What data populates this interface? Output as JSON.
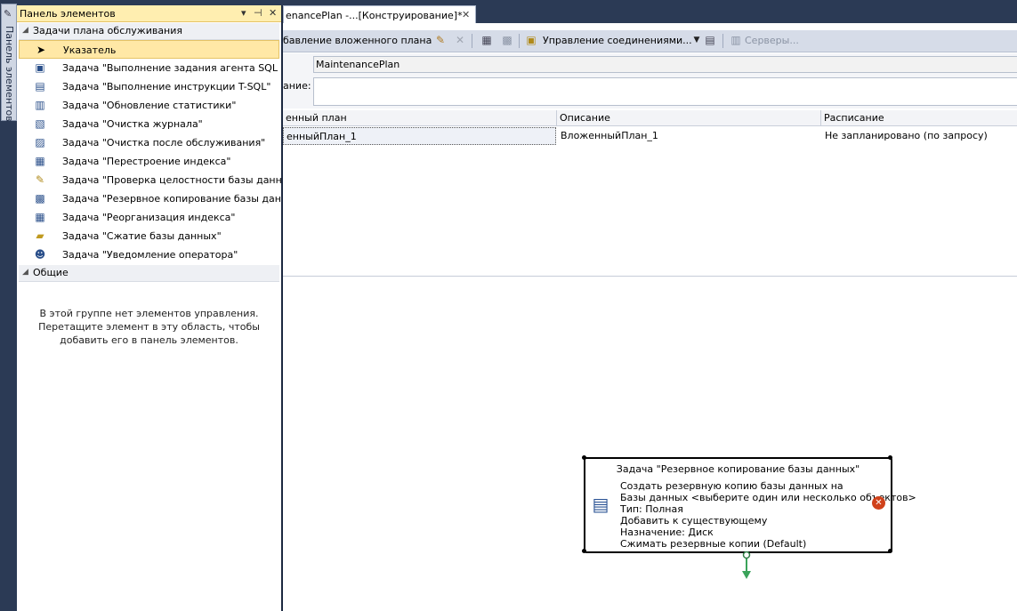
{
  "side_tab": {
    "label": "Панель элементов"
  },
  "toolbox": {
    "title": "Панель элементов",
    "groups": [
      {
        "label": "Задачи плана обслуживания",
        "items": [
          {
            "label": "Указатель",
            "icon": "pointer-icon"
          },
          {
            "label": "Задача \"Выполнение задания агента SQL Server\"",
            "icon": "agent-job-icon"
          },
          {
            "label": "Задача \"Выполнение инструкции T-SQL\"",
            "icon": "tsql-icon"
          },
          {
            "label": "Задача \"Обновление статистики\"",
            "icon": "statistics-icon"
          },
          {
            "label": "Задача \"Очистка журнала\"",
            "icon": "history-cleanup-icon"
          },
          {
            "label": "Задача \"Очистка после обслуживания\"",
            "icon": "maintenance-cleanup-icon"
          },
          {
            "label": "Задача \"Перестроение индекса\"",
            "icon": "rebuild-index-icon"
          },
          {
            "label": "Задача \"Проверка целостности базы данных\"",
            "icon": "integrity-check-icon"
          },
          {
            "label": "Задача \"Резервное копирование базы данных\"",
            "icon": "backup-icon"
          },
          {
            "label": "Задача \"Реорганизация индекса\"",
            "icon": "reorganize-index-icon"
          },
          {
            "label": "Задача \"Сжатие базы данных\"",
            "icon": "shrink-icon"
          },
          {
            "label": "Задача \"Уведомление оператора\"",
            "icon": "notify-operator-icon"
          }
        ]
      },
      {
        "label": "Общие",
        "empty_message": "В этой группе нет элементов управления. Перетащите элемент в эту область, чтобы добавить его в панель элементов."
      }
    ]
  },
  "document_tab": {
    "title": "enancePlan -...[Конструирование]*"
  },
  "toolbar": {
    "add_subplan_label": "бавление вложенного плана",
    "manage_connections_label": "Управление соединениями...",
    "servers_label": "Серверы..."
  },
  "properties": {
    "name_value": "MaintenancePlan",
    "description_label": "ание:"
  },
  "subplans_grid": {
    "columns": [
      "енный план",
      "Описание",
      "Расписание"
    ],
    "rows": [
      [
        "енныйПлан_1",
        "ВложенныйПлан_1",
        "Не запланировано (по запросу)"
      ]
    ]
  },
  "task_box": {
    "title": "Задача \"Резервное копирование базы данных\"",
    "lines": [
      "Создать резервную копию базы данных на",
      "Базы данных <выберите один или несколько объектов>",
      "Тип: Полная",
      "Добавить к существующему",
      "Назначение: Диск",
      "Сжимать резервные копии (Default)"
    ],
    "error_glyph": "✕"
  },
  "colors": {
    "frame": "#2b3a55",
    "selection": "#ffe8a6",
    "success_arrow": "#3aa35a",
    "error": "#d0421b"
  }
}
